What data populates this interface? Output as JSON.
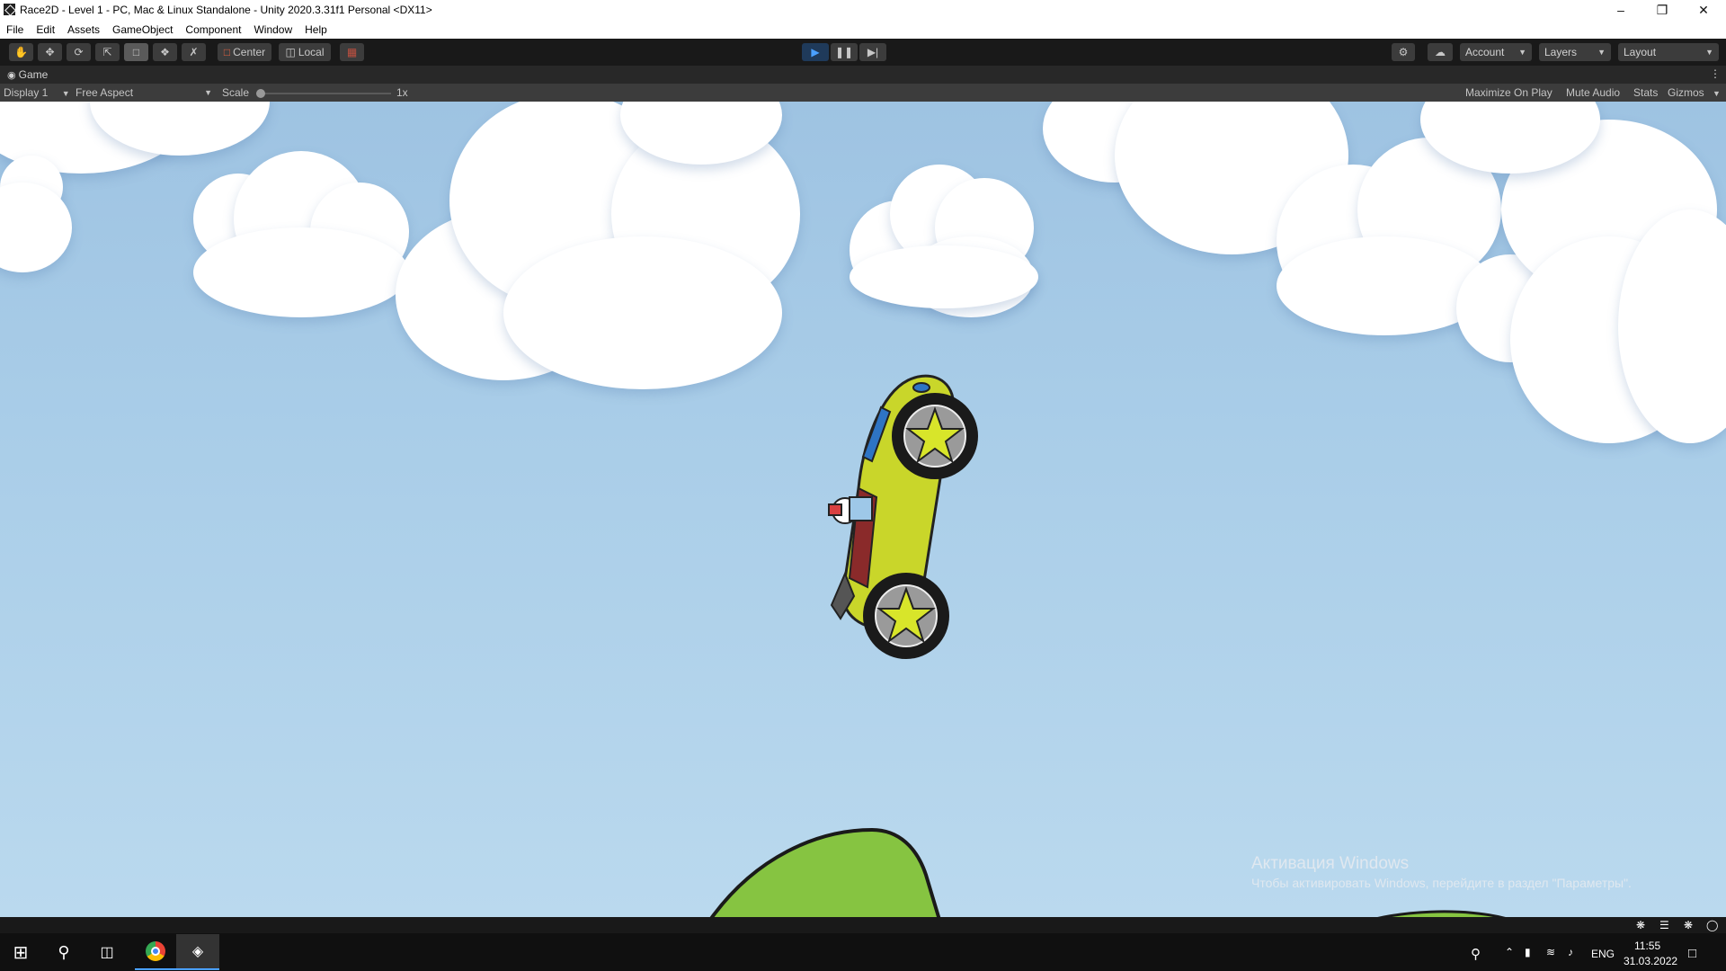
{
  "window": {
    "title": "Race2D - Level 1 - PC, Mac & Linux Standalone - Unity 2020.3.31f1 Personal <DX11>",
    "controls": [
      "minimize",
      "restore",
      "close"
    ]
  },
  "menu": [
    "File",
    "Edit",
    "Assets",
    "GameObject",
    "Component",
    "Window",
    "Help"
  ],
  "toolbar": {
    "tools": [
      "hand-tool",
      "move-tool",
      "rotate-tool",
      "scale-tool",
      "rect-tool",
      "transform-tool",
      "custom-tool"
    ],
    "pivot_mode": "Center",
    "pivot_rotation": "Local",
    "account": "Account",
    "layers": "Layers",
    "layout": "Layout"
  },
  "game_tab": {
    "label": "Game",
    "display": "Display 1",
    "aspect": "Free Aspect",
    "scale_label": "Scale",
    "scale_value": "1x",
    "maximize_on_play": "Maximize On Play",
    "mute_audio": "Mute Audio",
    "stats": "Stats",
    "gizmos": "Gizmos"
  },
  "watermark": {
    "title": "Активация Windows",
    "subtitle": "Чтобы активировать Windows, перейдите в раздел \"Параметры\"."
  },
  "taskbar": {
    "language": "ENG",
    "time": "11:55",
    "date": "31.03.2022"
  },
  "colors": {
    "sky_top": "#9ec3e2",
    "sky_bottom": "#bad9ee",
    "car_body": "#c9d62a",
    "hill": "#86c441",
    "play_accent": "#4aa0ff"
  }
}
